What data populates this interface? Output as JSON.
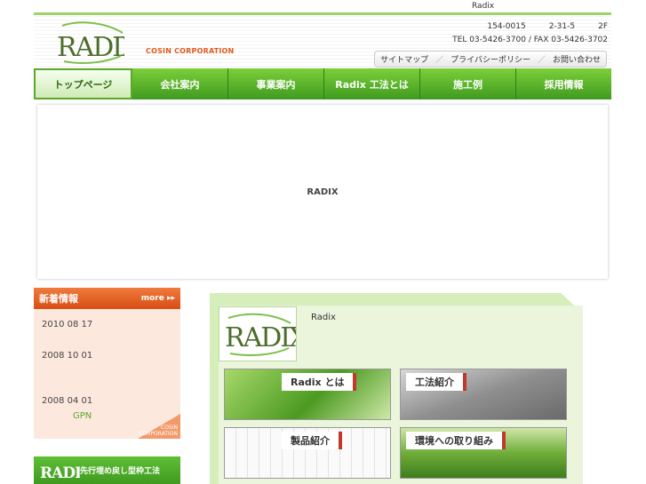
{
  "tagline": "Radix",
  "header": {
    "company_en": "COSIN CORPORATION",
    "postal": "154-0015",
    "addr1": "2-31-5",
    "addr2": "2F",
    "tel": "TEL 03-5426-3700 / FAX 03-5426-3702",
    "util_links": [
      "サイトマップ",
      "プライバシーポリシー",
      "お問い合わせ"
    ]
  },
  "nav": [
    "トップページ",
    "会社案内",
    "事業案内",
    "Radix 工法とは",
    "施工例",
    "採用情報"
  ],
  "hero": {
    "text": "RADIX"
  },
  "news": {
    "title": "新着情報",
    "more": "more",
    "items": [
      {
        "date": "2010 08 17",
        "text": ""
      },
      {
        "date": "2008 10 01",
        "text": ""
      },
      {
        "date": "2008 04 01",
        "text": "GPN"
      }
    ],
    "corner": "COSIN\nCORPORATION"
  },
  "banner": {
    "text": "先行埋め戻し型枠工法"
  },
  "panel": {
    "intro": "Radix",
    "cards": [
      "Radix とは",
      "工法紹介",
      "製品紹介",
      "環境への取り組み"
    ]
  },
  "colors": {
    "brand_green": "#4aa52a",
    "accent_orange": "#e05a1c"
  }
}
